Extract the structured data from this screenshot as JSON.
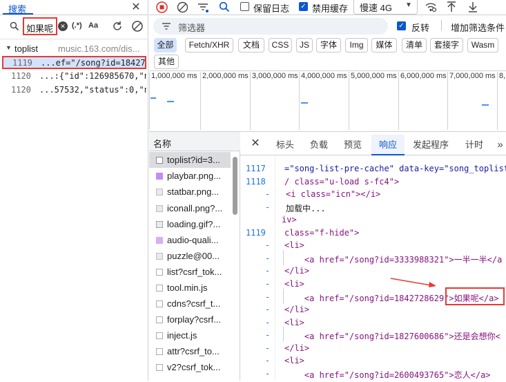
{
  "search_panel": {
    "tab_label": "搜索",
    "query": "如果呢",
    "regex_label": "(.*)",
    "case_label": "Aa",
    "result_group": "toplist",
    "result_group_url": "music.163.com/dis...",
    "results": [
      {
        "line": "1119",
        "text": "...ef=\"/song?id=18427..."
      },
      {
        "line": "1120",
        "text": "...:{\"id\":126985670,\"na..."
      },
      {
        "line": "1120",
        "text": "...57532,\"status\":0,\"na..."
      }
    ]
  },
  "toolbar": {
    "preserve_log": "保留日志",
    "disable_cache": "禁用缓存",
    "throttle": "慢速 4G",
    "preserve_log_checked": false,
    "disable_cache_checked": true
  },
  "filter": {
    "placeholder": "筛选器",
    "invert_label": "反转",
    "invert_checked": true,
    "more_filters": "增加筛选条件"
  },
  "type_chips": [
    "全部",
    "Fetch/XHR",
    "文档",
    "CSS",
    "JS",
    "字体",
    "Img",
    "媒体",
    "清单",
    "套接字",
    "Wasm",
    "其他"
  ],
  "timeline_ticks": [
    "1,000,000 ms",
    "2,000,000 ms",
    "3,000,000 ms",
    "4,000,000 ms",
    "5,000,000 ms",
    "6,000,000 ms",
    "7,000,000 ms",
    "8,"
  ],
  "request_list": {
    "header": "名称",
    "items": [
      "toplist?id=3...",
      "playbar.png...",
      "statbar.png...",
      "iconall.png?...",
      "loading.gif?...",
      "audio-quali...",
      "puzzle@00...",
      "list?csrf_tok...",
      "tool.min.js",
      "cdns?csrf_t...",
      "forplay?csrf...",
      "inject.js",
      "attr?csrf_to...",
      "v2?csrf_tok..."
    ]
  },
  "detail_tabs": [
    "标头",
    "负载",
    "预览",
    "响应",
    "发起程序",
    "计时"
  ],
  "active_tab": "响应",
  "more_tabs": "»",
  "response_lines": [
    {
      "ln": "1117",
      "html": "=\"song-list-pre-cache\" data-key=\"song_toplist"
    },
    {
      "ln": "1118",
      "html": "/ class=\"u-load s-fc4\">"
    },
    {
      "ln": "-",
      "html": "<i class=\"icn\"></i>"
    },
    {
      "ln": "-",
      "html": "加载中..."
    },
    {
      "ln": "",
      "html": "iv>"
    },
    {
      "ln": "1119",
      "html": "class=\"f-hide\">"
    },
    {
      "ln": "-",
      "html": "<li>"
    },
    {
      "ln": "-",
      "html": "    <a href=\"/song?id=3333988321\">一半一半</a"
    },
    {
      "ln": "-",
      "html": "</li>"
    },
    {
      "ln": "-",
      "html": "<li>"
    },
    {
      "ln": "-",
      "html": "    <a href=\"/song?id=1842728629\">如果呢</a>"
    },
    {
      "ln": "-",
      "html": "</li>"
    },
    {
      "ln": "-",
      "html": "<li>"
    },
    {
      "ln": "-",
      "html": "    <a href=\"/song?id=1827600686\">还是会想你<"
    },
    {
      "ln": "-",
      "html": "</li>"
    },
    {
      "ln": "-",
      "html": "<li>"
    },
    {
      "ln": "-",
      "html": "    <a href=\"/song?id=2600493765\">恋人</a>"
    }
  ],
  "colors": {
    "accent": "#0b57d0",
    "highlight_red": "#e53935",
    "record_red": "#d93025",
    "selected_bg": "#d3e3fd",
    "timeline_bar": "#4b8ef7"
  }
}
